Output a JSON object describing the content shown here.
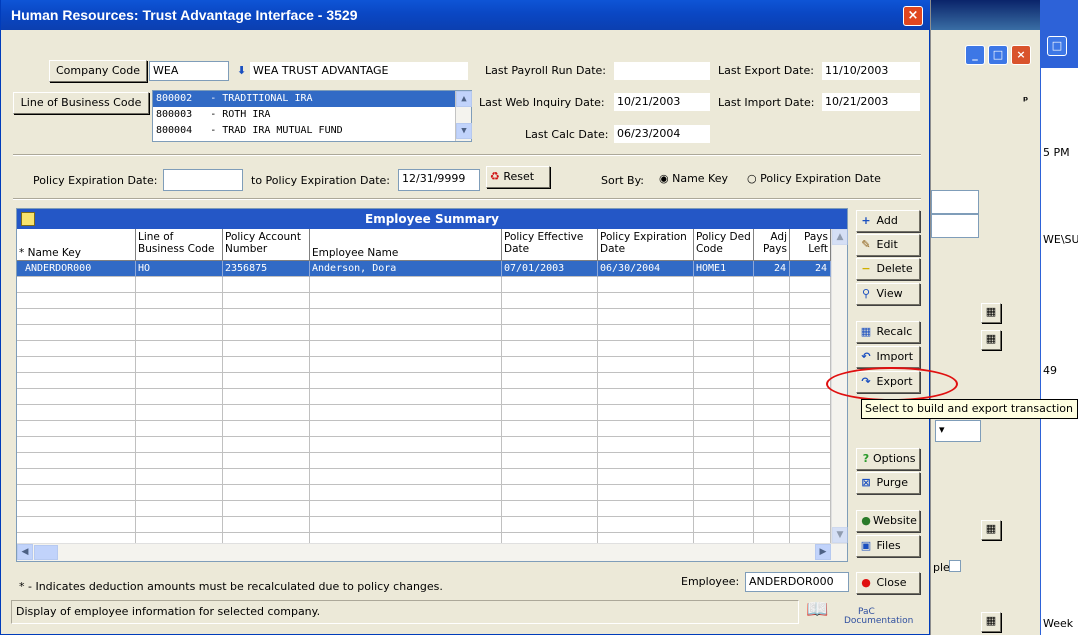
{
  "window": {
    "title": "Human Resources: Trust Advantage Interface - 3529",
    "close_glyph": "×"
  },
  "header": {
    "company_code_label": "Company Code",
    "company_code_value": "WEA",
    "company_name": "WEA TRUST ADVANTAGE",
    "lob_label": "Line of Business Code",
    "lob_items": [
      {
        "code": "800002",
        "desc": "- TRADITIONAL IRA",
        "selected": true
      },
      {
        "code": "800003",
        "desc": "- ROTH IRA",
        "selected": false
      },
      {
        "code": "800004",
        "desc": "- TRAD IRA MUTUAL FUND",
        "selected": false
      }
    ],
    "last_payroll_label": "Last Payroll Run Date:",
    "last_payroll_value": "",
    "last_export_label": "Last Export Date:",
    "last_export_value": "11/10/2003",
    "last_web_label": "Last Web Inquiry Date:",
    "last_web_value": "10/21/2003",
    "last_import_label": "Last Import Date:",
    "last_import_value": "10/21/2003",
    "last_calc_label": "Last Calc Date:",
    "last_calc_value": "06/23/2004"
  },
  "filters": {
    "policy_exp_label": "Policy Expiration Date:",
    "policy_exp_value": "",
    "to_policy_exp_label": "to Policy Expiration Date:",
    "to_policy_exp_value": "12/31/9999",
    "reset_label": "Reset",
    "sort_by_label": "Sort By:",
    "sort_options": [
      {
        "label": "Name Key",
        "checked": true
      },
      {
        "label": "Policy Expiration Date",
        "checked": false
      }
    ]
  },
  "grid": {
    "title": "Employee Summary",
    "columns": [
      {
        "label": "* Name Key",
        "two_line": false
      },
      {
        "label": "Line of Business Code",
        "two_line": true
      },
      {
        "label": "Policy Account Number",
        "two_line": true
      },
      {
        "label": "Employee Name",
        "two_line": false
      },
      {
        "label": "Policy Effective Date",
        "two_line": true
      },
      {
        "label": "Policy Expiration Date",
        "two_line": true
      },
      {
        "label": "Policy Ded Code",
        "two_line": true
      },
      {
        "label": "Adj Pays",
        "two_line": true
      },
      {
        "label": "Pays Left",
        "two_line": true
      }
    ],
    "rows": [
      [
        "ANDERDOR000",
        "HO",
        "2356875",
        "Anderson, Dora",
        "07/01/2003",
        "06/30/2004",
        "HOME1",
        "24",
        "24"
      ]
    ],
    "footnote": "* - Indicates deduction amounts must be recalculated due to policy changes."
  },
  "side_buttons": {
    "add": "Add",
    "edit": "Edit",
    "delete": "Delete",
    "view": "View",
    "recalc": "Recalc",
    "import": "Import",
    "export": "Export",
    "options": "Options",
    "purge": "Purge",
    "website": "Website",
    "files": "Files",
    "close": "Close"
  },
  "tooltip": "Select to build and export transaction",
  "employee_label": "Employee:",
  "employee_value": "ANDERDOR000",
  "status": "Display of employee information for selected company.",
  "logo": {
    "line1": "PaC",
    "line2": "Documentation"
  },
  "background": {
    "pm_text": "5 PM",
    "path_text": "WE\\SU",
    "num_text": "49",
    "ple_text": "ple",
    "week_text": "Week"
  }
}
